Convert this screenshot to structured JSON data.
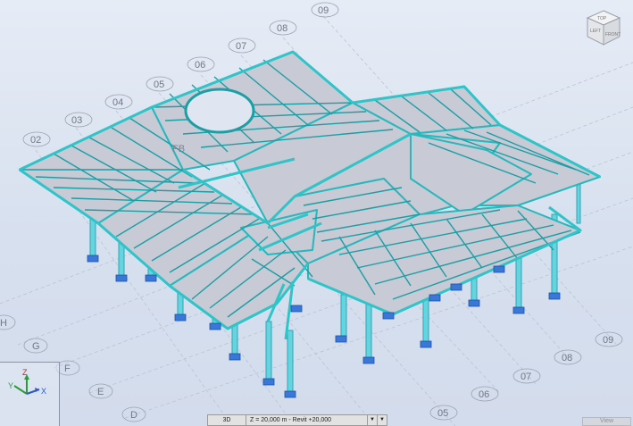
{
  "grid_bubbles": {
    "top": [
      "09",
      "08",
      "07",
      "06",
      "05",
      "04",
      "03",
      "02"
    ],
    "left": [
      "H",
      "G",
      "F",
      "E",
      "D"
    ],
    "bottom_right": [
      "09",
      "08",
      "07",
      "06",
      "05"
    ]
  },
  "model_labels": {
    "roof_tag": "FB"
  },
  "viewcube": {
    "top_label": "TOP",
    "front_label": "FRONT",
    "left_label": "LEFT"
  },
  "axis": {
    "z": "Z",
    "y": "Y",
    "x": "X"
  },
  "statusbar": {
    "view_mode": "3D",
    "level": "Z = 20,000 m - Revit +20,000",
    "arrow_left": "▼",
    "arrow_right": "▼"
  },
  "view_tab": "View",
  "colors": {
    "beam": "#2ec0c4",
    "beam_dark": "#128a8e",
    "panel": "#c9ccd6",
    "support": "#2f6fd6",
    "column": "#5fd0dc"
  }
}
